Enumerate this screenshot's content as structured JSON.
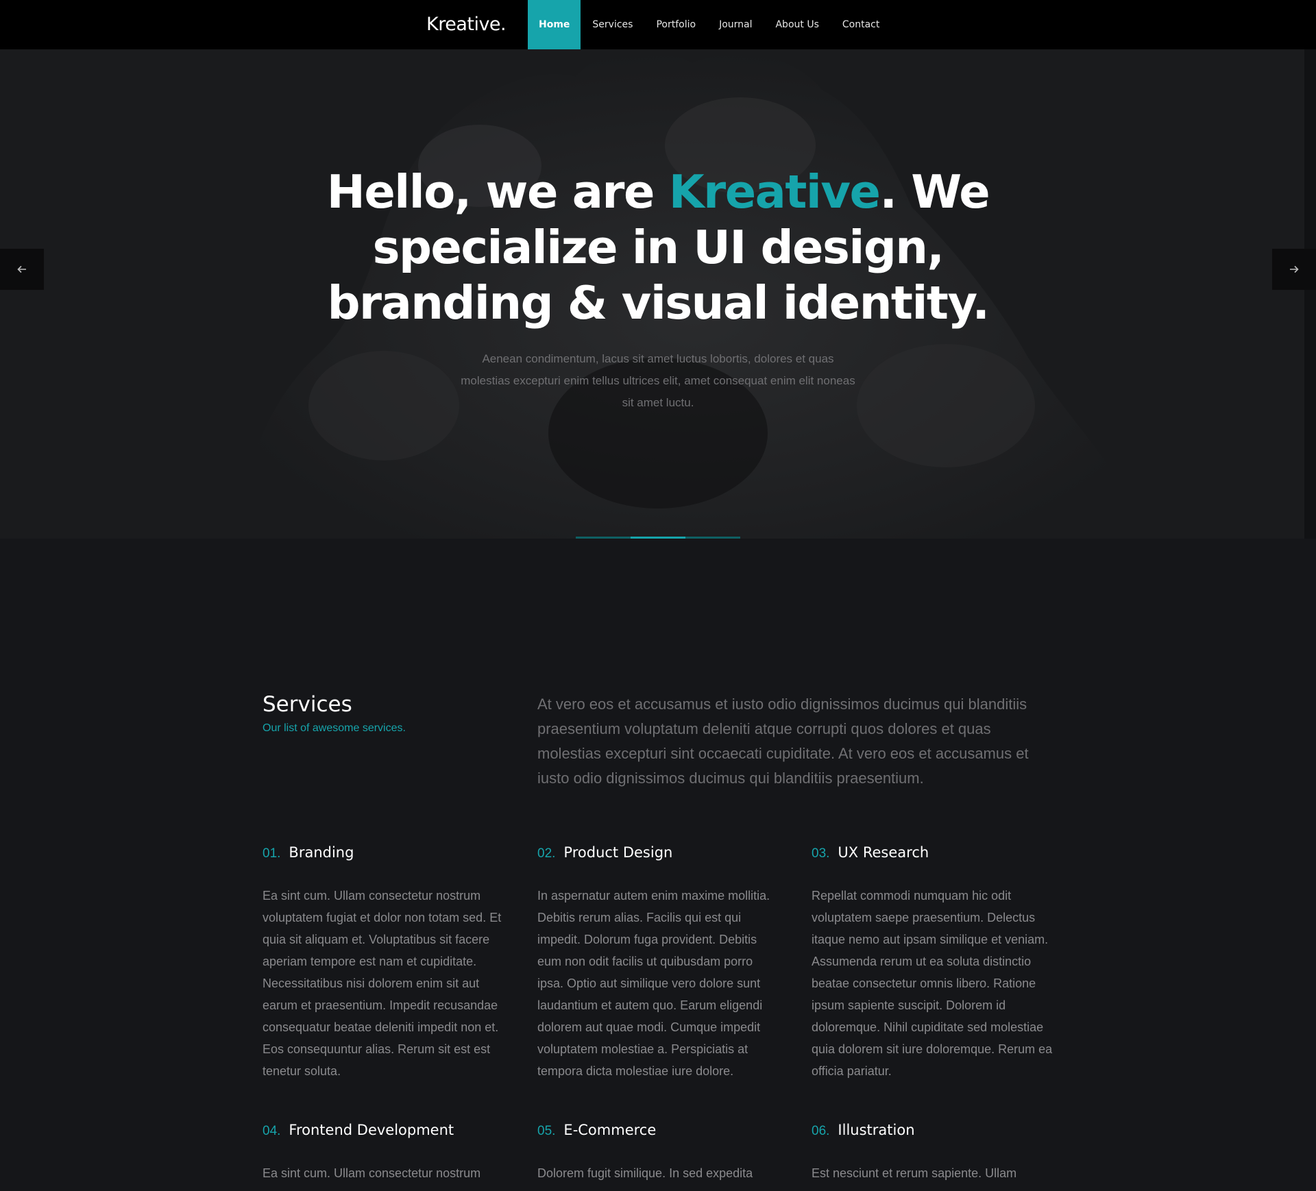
{
  "header": {
    "logo": "Kreative.",
    "nav": [
      {
        "label": "Home",
        "active": true
      },
      {
        "label": "Services",
        "active": false
      },
      {
        "label": "Portfolio",
        "active": false
      },
      {
        "label": "Journal",
        "active": false
      },
      {
        "label": "About Us",
        "active": false
      },
      {
        "label": "Contact",
        "active": false
      }
    ]
  },
  "hero": {
    "title_part1": "Hello, we are ",
    "title_accent": "Kreative",
    "title_part2": ". We specialize in UI design, branding & visual identity.",
    "subtitle": "Aenean condimentum, lacus sit amet luctus lobortis, dolores et quas molestias excepturi enim tellus ultrices elit, amet consequat enim elit noneas sit amet luctu.",
    "prev_icon": "arrow-left-icon",
    "next_icon": "arrow-right-icon",
    "slides": 3,
    "active_slide": 2
  },
  "services": {
    "title": "Services",
    "tagline": "Our list of awesome services.",
    "intro": "At vero eos et accusamus et iusto odio dignissimos ducimus qui blanditiis praesentium voluptatum deleniti atque corrupti quos dolores et quas molestias excepturi sint occaecati cupiditate. At vero eos et accusamus et iusto odio dignissimos ducimus qui blanditiis praesentium.",
    "items": [
      {
        "num": "01.",
        "title": "Branding",
        "text": "Ea sint cum. Ullam consectetur nostrum voluptatem fugiat et dolor non totam sed. Et quia sit aliquam et. Voluptatibus sit facere aperiam tempore est nam et cupiditate. Necessitatibus nisi dolorem enim sit aut earum et praesentium. Impedit recusandae consequatur beatae deleniti impedit non et. Eos consequuntur alias. Rerum sit est est tenetur soluta."
      },
      {
        "num": "02.",
        "title": "Product Design",
        "text": "In aspernatur autem enim maxime mollitia. Debitis rerum alias. Facilis qui est qui impedit. Dolorum fuga provident. Debitis eum non odit facilis ut quibusdam porro ipsa. Optio aut similique vero dolore sunt laudantium et autem quo. Earum eligendi dolorem aut quae modi. Cumque impedit voluptatem molestiae a. Perspiciatis at tempora dicta molestiae iure dolore."
      },
      {
        "num": "03.",
        "title": "UX Research",
        "text": "Repellat commodi numquam hic odit voluptatem saepe praesentium. Delectus itaque nemo aut ipsam similique et veniam. Assumenda rerum ut ea soluta distinctio beatae consectetur omnis libero. Ratione ipsum sapiente suscipit. Dolorem id doloremque. Nihil cupiditate sed molestiae quia dolorem sit iure doloremque. Rerum ea officia pariatur."
      },
      {
        "num": "04.",
        "title": "Frontend Development",
        "text": "Ea sint cum. Ullam consectetur nostrum"
      },
      {
        "num": "05.",
        "title": "E-Commerce",
        "text": "Dolorem fugit similique. In sed expedita"
      },
      {
        "num": "06.",
        "title": "Illustration",
        "text": "Est nesciunt et rerum sapiente. Ullam"
      }
    ]
  },
  "colors": {
    "accent": "#16a4ab",
    "header_bg": "#000000",
    "page_bg": "#151619"
  }
}
